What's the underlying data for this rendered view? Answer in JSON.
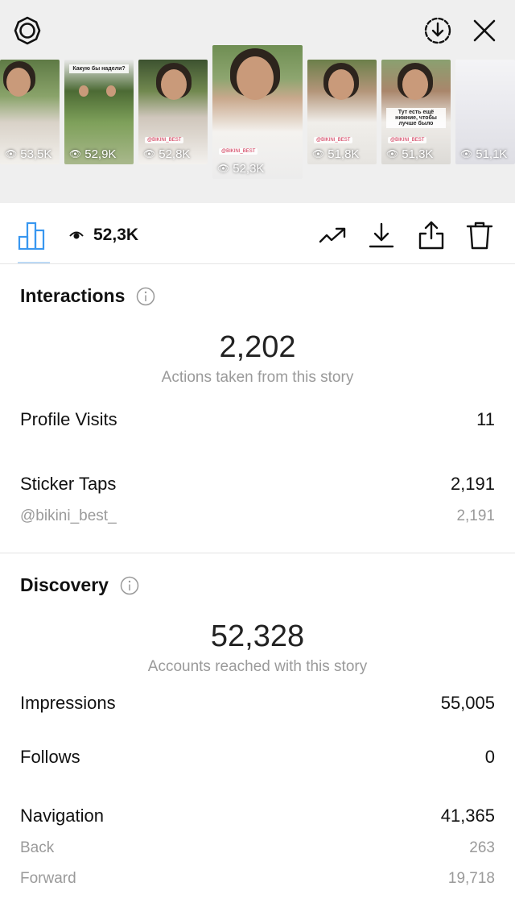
{
  "thumbnails": [
    {
      "views": "53,5K",
      "caption": "",
      "tag": ""
    },
    {
      "views": "52,9K",
      "caption": "Какую бы надели?",
      "tag": ""
    },
    {
      "views": "52,8K",
      "caption": "",
      "tag": "@BIKINI_BEST"
    },
    {
      "views": "52,3K",
      "caption": "",
      "tag": "@BIKINI_BEST"
    },
    {
      "views": "51,8K",
      "caption": "",
      "tag": "@BIKINI_BEST"
    },
    {
      "views": "51,3K",
      "caption": "Тут есть ещё нижние, чтобы лучше было",
      "tag": "@BIKINI_BEST"
    },
    {
      "views": "51,1K",
      "caption": "",
      "tag": ""
    }
  ],
  "toolbar": {
    "views": "52,3K"
  },
  "interactions": {
    "title": "Interactions",
    "total": "2,202",
    "caption": "Actions taken from this story",
    "rows": [
      {
        "label": "Profile Visits",
        "value": "11"
      },
      {
        "label": "Sticker Taps",
        "value": "2,191"
      },
      {
        "label": "@bikini_best_",
        "value": "2,191"
      }
    ]
  },
  "discovery": {
    "title": "Discovery",
    "total": "52,328",
    "caption": "Accounts reached with this story",
    "rows": [
      {
        "label": "Impressions",
        "value": "55,005"
      },
      {
        "label": "Follows",
        "value": "0"
      },
      {
        "label": "Navigation",
        "value": "41,365"
      },
      {
        "label": "Back",
        "value": "263"
      },
      {
        "label": "Forward",
        "value": "19,718"
      }
    ]
  },
  "icons": {
    "settings": "gear-icon",
    "save": "download-circle-icon",
    "close": "close-icon",
    "insights": "bar-chart-icon",
    "eye": "eye-icon",
    "promote": "trend-up-icon",
    "download": "download-icon",
    "share": "share-icon",
    "delete": "trash-icon",
    "info": "info-icon"
  }
}
